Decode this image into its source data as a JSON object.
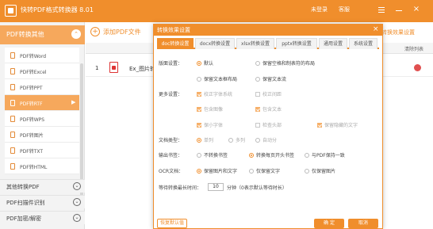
{
  "app": {
    "title": "快转PDF格式转换器 8.01",
    "login_label": "未登录",
    "help_label": "客服"
  },
  "sidebar": {
    "section_title": "PDF转换其他",
    "items": [
      {
        "label": "PDF转Word"
      },
      {
        "label": "PDF转Excel"
      },
      {
        "label": "PDF转PPT"
      },
      {
        "label": "PDF转RTF"
      },
      {
        "label": "PDF转WPS"
      },
      {
        "label": "PDF转图片"
      },
      {
        "label": "PDF转TXT"
      },
      {
        "label": "PDF转HTML"
      }
    ],
    "active_item": "PDF转RTF",
    "categories": [
      {
        "label": "其他转换PDF"
      },
      {
        "label": "PDF扫描件识别"
      },
      {
        "label": "PDF加密/解密"
      }
    ]
  },
  "main": {
    "add_button": "添加PDF文件",
    "effect_settings": "转换效果设置",
    "delete_column": "清除列表",
    "files": [
      {
        "index": "1",
        "name": "Ex_图片转..."
      }
    ]
  },
  "dialog": {
    "title": "转换效果设置",
    "close": "×",
    "tabs": [
      {
        "label": "doc转换设置"
      },
      {
        "label": "docx转换设置"
      },
      {
        "label": "xlsx转换设置"
      },
      {
        "label": "pptx转换设置"
      },
      {
        "label": "通用设置"
      },
      {
        "label": "系统设置"
      }
    ],
    "active_tab": "doc转换设置",
    "layout": {
      "label": "版面设置：",
      "opt_default": "默认",
      "opt_keep_blank": "保留空格和制表符的布局",
      "opt_keep_text_layout": "保留文本框布局",
      "opt_keep_text_flow": "保留文本流"
    },
    "more": {
      "label": "更多设置：",
      "opt_correct_font": "校正字体系统",
      "opt_correct_space": "校正间距",
      "opt_include_image": "包含图像",
      "opt_include_text": "包含文本",
      "opt_keep_small": "保小字体",
      "opt_check_header": "检查头部",
      "opt_keep_hidden": "保留隐藏的文字"
    },
    "doc_type": {
      "label": "文档类型：",
      "opt_single": "单列",
      "opt_multi": "多列",
      "opt_auto": "自动分"
    },
    "page_break": {
      "label": "输出书签：",
      "opt_no_bookmark": "不转换书签",
      "opt_convert_page_bookmark": "转换每页开头书签",
      "opt_pdf_same": "与PDF保持一致"
    },
    "ocr": {
      "label": "OCR文档：",
      "opt_keep_image_text": "保留图片和文字",
      "opt_keep_text": "仅保留文字",
      "opt_keep_image": "仅保留图片"
    },
    "wait": {
      "label": "等待转换最长时间：",
      "value": "10",
      "unit": "分钟（0表示默认等待时长）"
    },
    "reset_button": "恢复默认值",
    "ok_button": "确 定",
    "cancel_button": "取消"
  }
}
